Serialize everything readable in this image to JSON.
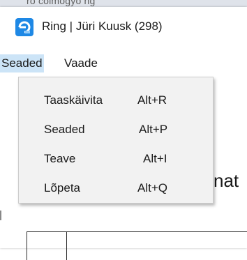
{
  "background": {
    "obscured_text": "ro colmogyo ng"
  },
  "window": {
    "title": "Ring | Jüri Kuusk (298)",
    "icon": "ring-app-icon",
    "accent_color": "#1e88e5"
  },
  "menubar": {
    "items": [
      {
        "label": "Seaded",
        "active": true
      },
      {
        "label": "Vaade",
        "active": false
      }
    ]
  },
  "dropdown": {
    "items": [
      {
        "label": "Taaskäivita",
        "shortcut": "Alt+R"
      },
      {
        "label": "Seaded",
        "shortcut": "Alt+P"
      },
      {
        "label": "Teave",
        "shortcut": "Alt+I"
      },
      {
        "label": "Lõpeta",
        "shortcut": "Alt+Q"
      }
    ]
  },
  "content": {
    "heading_fragment": "nat"
  }
}
